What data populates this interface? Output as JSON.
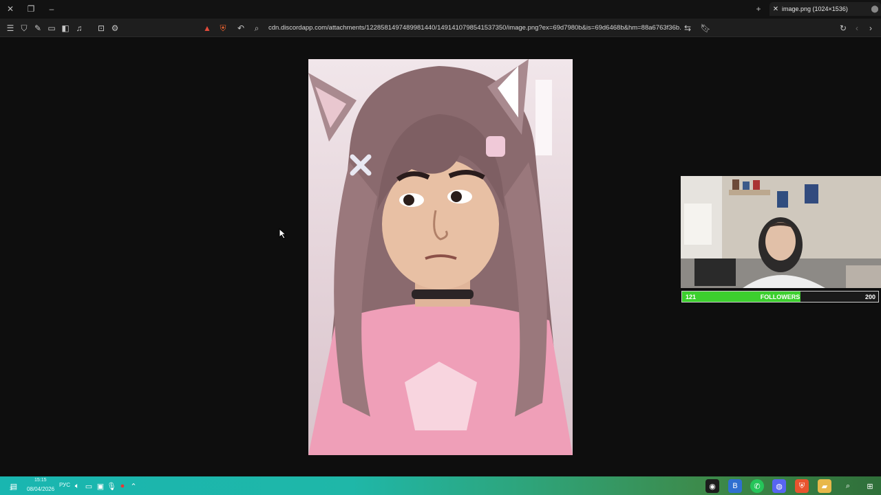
{
  "browser": {
    "tab_title": "image.png (1024×1536)",
    "url": "cdn.discordapp.com/attachments/1228581497489981440/1491410798541537350/image.png?ex=69d7980b&is=69d6468b&hm=88a6763f36b..."
  },
  "overlay": {
    "followers_current": "121",
    "followers_label": "FOLLOWERS",
    "followers_goal": "200",
    "followers_progress": 0.605
  },
  "taskbar": {
    "notification_count": "3",
    "time": "15:15",
    "date": "08/04/2026",
    "language": "РУС"
  },
  "colors": {
    "progress_fill": "#3ccf2e",
    "taskbar_accent": "#19b6b0"
  }
}
